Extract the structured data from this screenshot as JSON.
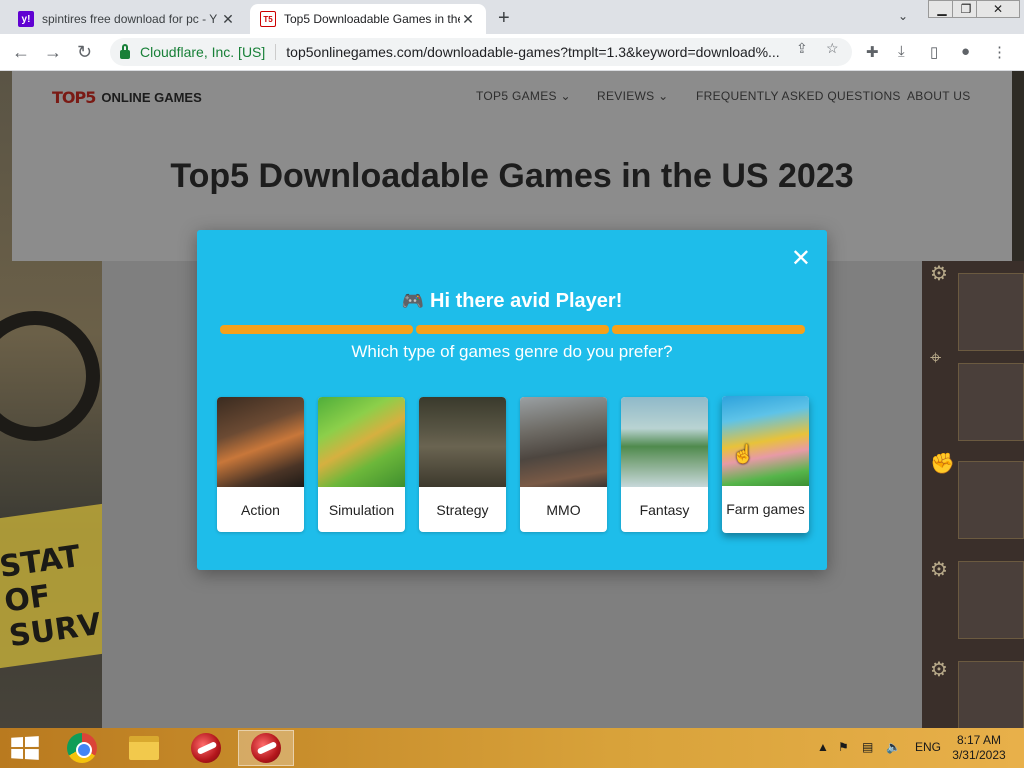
{
  "browser": {
    "tabs": [
      {
        "title": "spintires free download for pc - Y",
        "favicon": "yahoo-icon",
        "active": false
      },
      {
        "title": "Top5 Downloadable Games in the",
        "favicon": "t5-icon",
        "active": true
      }
    ],
    "omnibox": {
      "site_owner": "Cloudflare, Inc. [US]",
      "url": "top5onlinegames.com/downloadable-games?tmplt=1.3&keyword=download%..."
    }
  },
  "site": {
    "logo_mark": "TOP5",
    "logo_text": "ONLINE GAMES",
    "nav": [
      "TOP5 GAMES",
      "REVIEWS",
      "FREQUENTLY ASKED QUESTIONS",
      "ABOUT US"
    ],
    "headline": "Top5 Downloadable Games in the US 2023"
  },
  "modal": {
    "close_label": "✕",
    "heading": "Hi there avid Player!",
    "question": "Which type of games genre do you prefer?",
    "progress_filled_segments": 3,
    "progress_total_segments": 3,
    "genres": [
      {
        "label": "Action",
        "image": "action-game-image"
      },
      {
        "label": "Simulation",
        "image": "simulation-game-image"
      },
      {
        "label": "Strategy",
        "image": "strategy-game-image"
      },
      {
        "label": "MMO",
        "image": "mmo-game-image"
      },
      {
        "label": "Fantasy",
        "image": "fantasy-game-image"
      },
      {
        "label": "Farm games",
        "image": "farm-game-image"
      }
    ]
  },
  "background_game": {
    "sign_text": "STAT OF SURVIV"
  },
  "taskbar": {
    "apps": [
      "windows-start-icon",
      "chrome-icon",
      "file-explorer-icon",
      "app-red-icon",
      "app-red-icon"
    ],
    "language": "ENG",
    "time": "8:17 AM",
    "date": "3/31/2023"
  },
  "colors": {
    "modal_bg": "#1ebdea",
    "progress": "#f5a11b",
    "taskbar": "#d8a23a"
  }
}
